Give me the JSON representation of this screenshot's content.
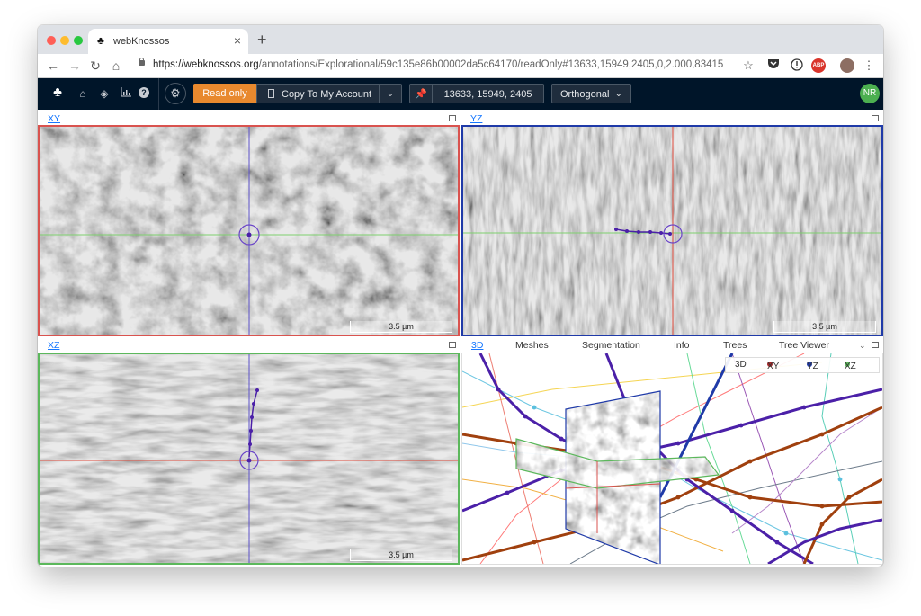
{
  "browser": {
    "tab_title": "webKnossos",
    "tab_close": "×",
    "new_tab": "+",
    "url_host": "https://webknossos.org",
    "url_path": "/annotations/Explorational/59c135e86b00002da5c64170/readOnly#13633,15949,2405,0,2.000,83415",
    "extensions": [
      "ABP"
    ]
  },
  "app": {
    "read_only_label": "Read only",
    "copy_label": "Copy To My Account",
    "position": "13633, 15949, 2405",
    "view_mode": "Orthogonal",
    "user_initials": "NR"
  },
  "viewports": {
    "xy": {
      "label": "XY",
      "scale": "3.5 µm",
      "border": "#d9534f"
    },
    "yz": {
      "label": "YZ",
      "scale": "3.5 µm",
      "border": "#1f3aa8"
    },
    "xz": {
      "label": "XZ",
      "scale": "3.5 µm",
      "border": "#5cb85c"
    }
  },
  "right_panel": {
    "tabs": [
      "3D",
      "Meshes",
      "Segmentation",
      "Info",
      "Trees",
      "Tree Viewer"
    ],
    "legend": [
      {
        "label": "3D",
        "color": ""
      },
      {
        "label": "XY",
        "color": "#a52a2a"
      },
      {
        "label": "YZ",
        "color": "#1f3aa8"
      },
      {
        "label": "XZ",
        "color": "#5cb85c"
      }
    ]
  },
  "colors": {
    "accent": "#e8892e",
    "nav_bg": "#001529",
    "skeleton_primary": "#4b20a8",
    "skeleton_secondary": "#a0400e",
    "user_avatar": "#4caf50"
  }
}
